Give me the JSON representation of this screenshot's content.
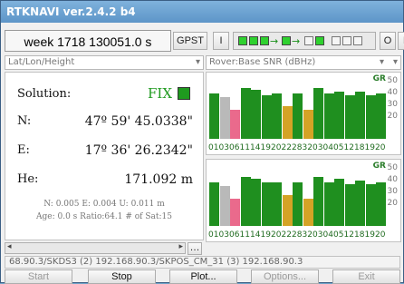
{
  "title": "RTKNAVI ver.2.4.2 b4",
  "toolbar": {
    "week_time": "week 1718 130051.0 s",
    "time_system": "GPST",
    "btn_i": "I",
    "btn_o": "O",
    "btn_l": "L"
  },
  "left_header": "Lat/Lon/Height",
  "right_header": "Rover:Base SNR (dBHz)",
  "solution": {
    "label": "Solution:",
    "status": "FIX",
    "status_color": "#1f9a1f",
    "n_label": "N:",
    "n_value": "47º 59' 45.0338\"",
    "e_label": "E:",
    "e_value": "17º 36' 26.2342\"",
    "h_label": "He:",
    "h_value": "171.092 m",
    "std": "N: 0.005 E: 0.004 U: 0.011 m",
    "age": "Age: 0.0 s Ratio:64.1 # of Sat:15"
  },
  "chart_data": [
    {
      "type": "bar",
      "categories": [
        "01",
        "03",
        "06",
        "11",
        "14",
        "19",
        "20",
        "22",
        "28",
        "32",
        "03",
        "04",
        "05",
        "12",
        "18",
        "19",
        "20"
      ],
      "colors": [
        "green",
        "gray",
        "pink",
        "green",
        "green",
        "green",
        "green",
        "orange",
        "green",
        "orange",
        "green",
        "green",
        "green",
        "green",
        "green",
        "green",
        "green"
      ],
      "values": [
        45,
        43,
        36,
        48,
        47,
        44,
        45,
        38,
        45,
        36,
        48,
        45,
        46,
        44,
        46,
        44,
        45
      ],
      "ylim": [
        20,
        50
      ],
      "ticks": [
        "50",
        "40",
        "30",
        "20"
      ],
      "label": "GR"
    },
    {
      "type": "bar",
      "categories": [
        "01",
        "03",
        "06",
        "11",
        "14",
        "19",
        "20",
        "22",
        "28",
        "32",
        "03",
        "04",
        "05",
        "12",
        "18",
        "19",
        "20"
      ],
      "colors": [
        "green",
        "gray",
        "pink",
        "green",
        "green",
        "green",
        "green",
        "orange",
        "green",
        "orange",
        "green",
        "green",
        "green",
        "green",
        "green",
        "green",
        "green"
      ],
      "values": [
        44,
        42,
        35,
        47,
        46,
        44,
        44,
        37,
        44,
        35,
        47,
        44,
        46,
        43,
        45,
        43,
        44
      ],
      "ylim": [
        20,
        50
      ],
      "ticks": [
        "50",
        "40",
        "30",
        "20"
      ],
      "label": "GR"
    }
  ],
  "status_line": "68.90.3/SKDS3 (2) 192.168.90.3/SKPOS_CM_31 (3) 192.168.90.3",
  "buttons": {
    "start": "Start",
    "stop": "Stop",
    "plot": "Plot...",
    "options": "Options...",
    "exit": "Exit"
  }
}
